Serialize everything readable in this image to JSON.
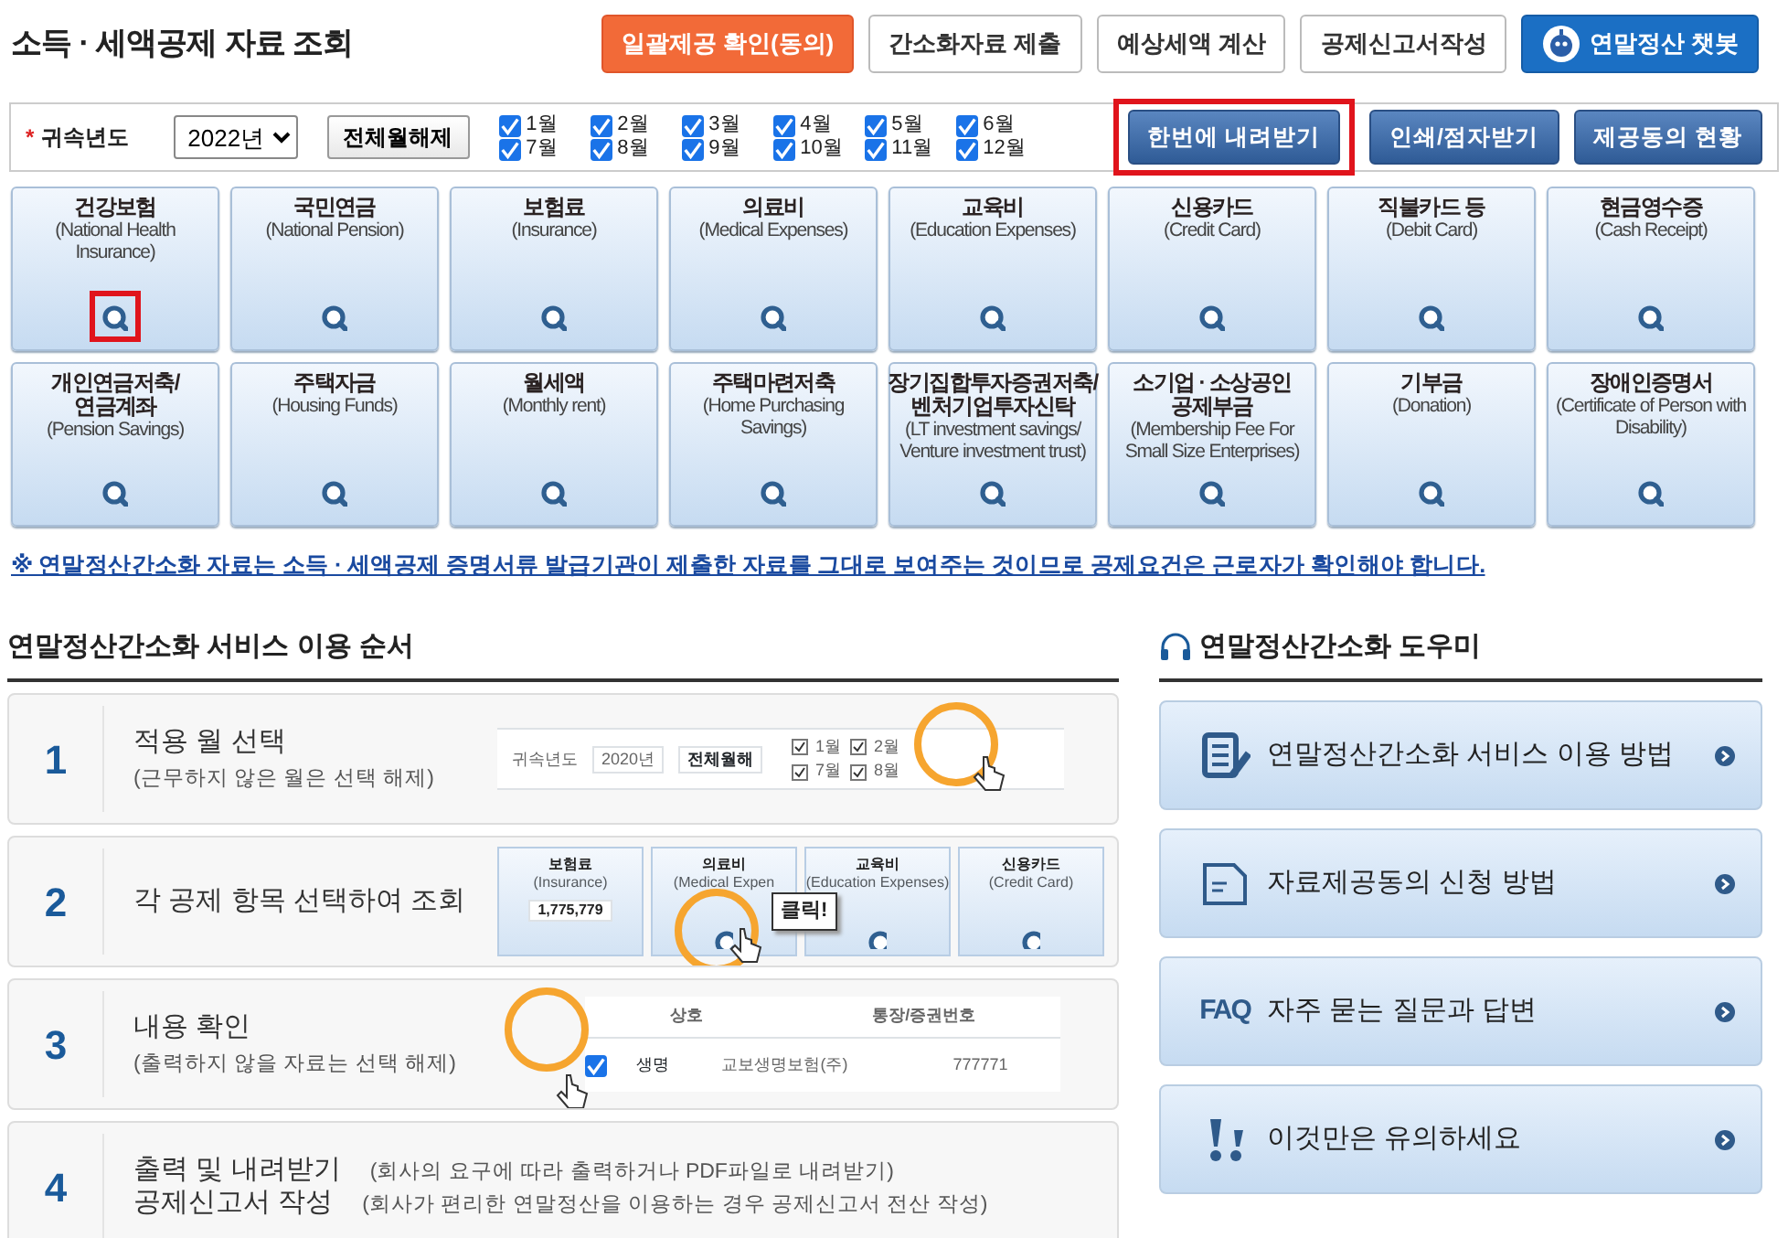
{
  "header": {
    "title": "소득 · 세액공제 자료 조회",
    "buttons": [
      {
        "label": "일괄제공 확인(동의)",
        "kind": "accent"
      },
      {
        "label": "간소화자료 제출",
        "kind": "plain"
      },
      {
        "label": "예상세액 계산",
        "kind": "plain"
      },
      {
        "label": "공제신고서작성",
        "kind": "plain"
      },
      {
        "label": "연말정산 챗봇",
        "kind": "chatbot"
      }
    ]
  },
  "filter": {
    "required_mark": "*",
    "label": "귀속년도",
    "year": "2022년",
    "clear_button": "전체월해제",
    "months": [
      {
        "label": "1월",
        "checked": true
      },
      {
        "label": "2월",
        "checked": true
      },
      {
        "label": "3월",
        "checked": true
      },
      {
        "label": "4월",
        "checked": true
      },
      {
        "label": "5월",
        "checked": true
      },
      {
        "label": "6월",
        "checked": true
      },
      {
        "label": "7월",
        "checked": true
      },
      {
        "label": "8월",
        "checked": true
      },
      {
        "label": "9월",
        "checked": true
      },
      {
        "label": "10월",
        "checked": true
      },
      {
        "label": "11월",
        "checked": true
      },
      {
        "label": "12월",
        "checked": true
      }
    ],
    "actions": [
      {
        "label": "한번에 내려받기",
        "highlighted": true
      },
      {
        "label": "인쇄/점자받기",
        "highlighted": false
      },
      {
        "label": "제공동의 현황",
        "highlighted": false
      }
    ]
  },
  "tiles": [
    {
      "title": "건강보험",
      "subtitle": "(National Health Insurance)",
      "highlighted": true
    },
    {
      "title": "국민연금",
      "subtitle": "(National Pension)",
      "highlighted": false
    },
    {
      "title": "보험료",
      "subtitle": "(Insurance)",
      "highlighted": false
    },
    {
      "title": "의료비",
      "subtitle": "(Medical Expenses)",
      "highlighted": false
    },
    {
      "title": "교육비",
      "subtitle": "(Education Expenses)",
      "highlighted": false
    },
    {
      "title": "신용카드",
      "subtitle": "(Credit Card)",
      "highlighted": false
    },
    {
      "title": "직불카드 등",
      "subtitle": "(Debit Card)",
      "highlighted": false
    },
    {
      "title": "현금영수증",
      "subtitle": "(Cash Receipt)",
      "highlighted": false
    },
    {
      "title": "개인연금저축/ 연금계좌",
      "subtitle": "(Pension Savings)",
      "highlighted": false
    },
    {
      "title": "주택자금",
      "subtitle": "(Housing Funds)",
      "highlighted": false
    },
    {
      "title": "월세액",
      "subtitle": "(Monthly rent)",
      "highlighted": false
    },
    {
      "title": "주택마련저축",
      "subtitle": "(Home Purchasing Savings)",
      "highlighted": false
    },
    {
      "title": "장기집합투자증권저축/ 벤처기업투자신탁",
      "subtitle": "(LT investment savings/ Venture investment trust)",
      "highlighted": false
    },
    {
      "title": "소기업 · 소상공인 공제부금",
      "subtitle": "(Membership Fee For Small Size Enterprises)",
      "highlighted": false
    },
    {
      "title": "기부금",
      "subtitle": "(Donation)",
      "highlighted": false
    },
    {
      "title": "장애인증명서",
      "subtitle": "(Certificate of Person with Disability)",
      "highlighted": false
    }
  ],
  "notice": "※ 연말정산간소화 자료는 소득 · 세액공제 증명서류 발급기관이 제출한 자료를 그대로 보여주는 것이므로 공제요건은 근로자가 확인해야 합니다.",
  "usage_guide": {
    "title": "연말정산간소화 서비스 이용 순서",
    "steps": [
      {
        "number": "1",
        "kind": "months",
        "title": "적용 월 선택",
        "note": "(근무하지 않은 월은 선택 해제)",
        "illustration": {
          "label": "귀속년도",
          "year": "2020년",
          "button": "전체월해",
          "months": [
            "1월",
            "7월",
            "2월",
            "8월"
          ]
        }
      },
      {
        "number": "2",
        "kind": "tiles",
        "title": "각 공제 항목 선택하여 조회",
        "illustration": {
          "tiles": [
            {
              "title": "보험료",
              "subtitle": "(Insurance)",
              "value": "1,775,779"
            },
            {
              "title": "의료비",
              "subtitle": "(Medical Expen"
            },
            {
              "title": "교육비",
              "subtitle": "(Education Expenses)"
            },
            {
              "title": "신용카드",
              "subtitle": "(Credit Card)"
            }
          ],
          "callout": "클릭!"
        }
      },
      {
        "number": "3",
        "kind": "table",
        "title": "내용 확인",
        "note": "(출력하지 않을 자료는 선택 해제)",
        "illustration": {
          "columns": [
            "상호",
            "통장/증권번호"
          ],
          "checked": true,
          "zoom_text": "생명",
          "cells": [
            "교보생명보험(주)",
            "777771"
          ]
        }
      },
      {
        "number": "4",
        "kind": "text",
        "lines": [
          {
            "title": "출력 및 내려받기",
            "note": "(회사의 요구에 따라 출력하거나 PDF파일로 내려받기)"
          },
          {
            "title": "공제신고서 작성",
            "note": "(회사가 편리한 연말정산을 이용하는 경우 공제신고서 전산 작성)"
          }
        ]
      }
    ]
  },
  "helper": {
    "title": "연말정산간소화 도우미",
    "items": [
      {
        "label": "연말정산간소화 서비스 이용 방법",
        "kind": "manual"
      },
      {
        "label": "자료제공동의 신청 방법",
        "kind": "form"
      },
      {
        "label": "자주 묻는 질문과 답변",
        "kind": "faq",
        "badge": "FAQ"
      },
      {
        "label": "이것만은 유의하세요",
        "kind": "caution"
      }
    ]
  }
}
